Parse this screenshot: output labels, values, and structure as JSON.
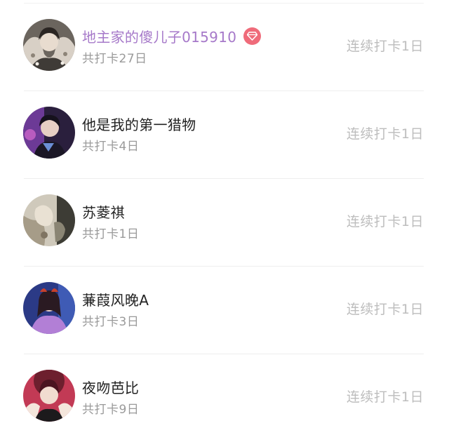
{
  "checkin_list": [
    {
      "username": "地主家的傻儿子015910",
      "is_vip": true,
      "vip_badge_icon": "diamond-icon",
      "total_checkins": "共打卡27日",
      "streak": "连续打卡1日",
      "name_color": "#a679c9",
      "avatar_colors": [
        "#5a5550",
        "#d9d1c8"
      ]
    },
    {
      "username": "他是我的第一猎物",
      "is_vip": false,
      "total_checkins": "共打卡4日",
      "streak": "连续打卡1日",
      "avatar_colors": [
        "#6a3d8f",
        "#1f1730"
      ]
    },
    {
      "username": "苏菱祺",
      "is_vip": false,
      "total_checkins": "共打卡1日",
      "streak": "连续打卡1日",
      "avatar_colors": [
        "#c9c4b6",
        "#4a4a40"
      ]
    },
    {
      "username": "蒹葭风晚A",
      "is_vip": false,
      "total_checkins": "共打卡3日",
      "streak": "连续打卡1日",
      "avatar_colors": [
        "#2f3e8c",
        "#b07ad0"
      ]
    },
    {
      "username": "夜吻芭比",
      "is_vip": false,
      "total_checkins": "共打卡9日",
      "streak": "连续打卡1日",
      "avatar_colors": [
        "#b3213f",
        "#f2d5c8"
      ]
    }
  ],
  "colors": {
    "vip_name": "#a679c9",
    "vip_badge": "#ef6b7a",
    "name": "#222222",
    "secondary": "#9a9a9a",
    "streak": "#bdbdbd"
  }
}
